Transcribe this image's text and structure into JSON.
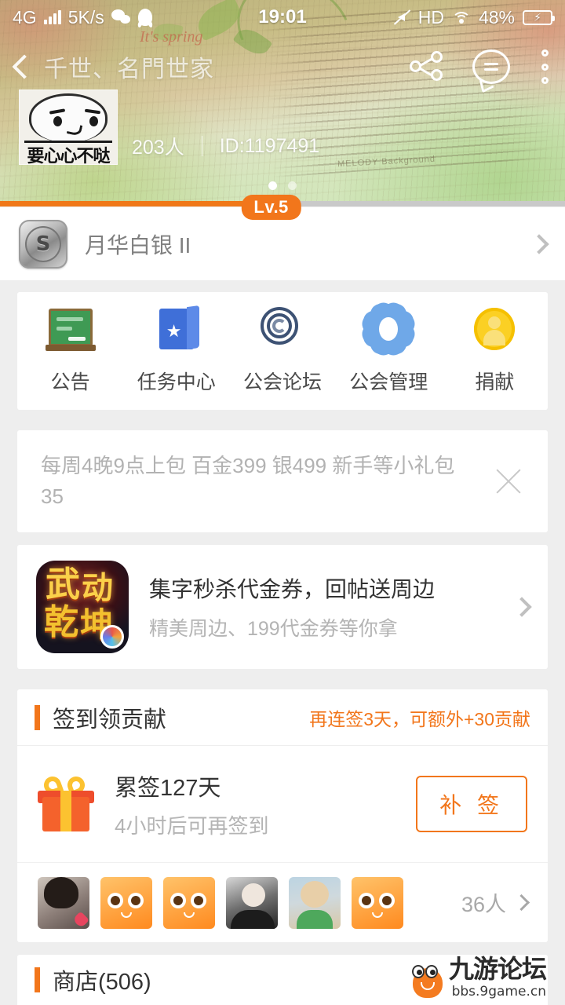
{
  "status_bar": {
    "network_type": "4G",
    "data_speed": "5K/s",
    "time": "19:01",
    "hd_label": "HD",
    "battery_percent": "48%",
    "icons": [
      "signal-bars-icon",
      "wechat-icon",
      "qq-icon",
      "mute-icon",
      "wifi-icon",
      "battery-charging-icon"
    ]
  },
  "header": {
    "back_label": "",
    "guild_title": "千世、名門世家",
    "guild_title_shadow": "千世、名門世家",
    "member_count": "203人",
    "guild_id": "ID:1197491",
    "avatar_caption": "要心心不哒",
    "page_dots": 2,
    "active_dot": 0,
    "level_badge": "Lv.5",
    "level_progress_percent": 48,
    "accent_color": "#f2761b"
  },
  "medal_row": {
    "badge_letter": "S",
    "name": "月华白银 II"
  },
  "icon_grid": [
    {
      "label": "公告",
      "icon": "announcement-board-icon"
    },
    {
      "label": "任务中心",
      "icon": "task-book-icon"
    },
    {
      "label": "公会论坛",
      "icon": "forum-spiral-icon"
    },
    {
      "label": "公会管理",
      "icon": "guild-gear-icon"
    },
    {
      "label": "捐献",
      "icon": "donate-coin-icon"
    }
  ],
  "announcement": {
    "text": "每周4晚9点上包 百金399 银499 新手等小礼包35",
    "close_icon": "close-icon"
  },
  "promo": {
    "game_name": "武动乾坤",
    "game_char_1": "武",
    "game_char_2": "动",
    "game_char_3": "乾",
    "game_char_4": "坤",
    "title": "集字秒杀代金券，回帖送周边",
    "subtitle": "精美周边、199代金券等你拿"
  },
  "signin": {
    "section_title": "签到领贡献",
    "hint": "再连签3天，可额外+30贡献",
    "total_days": "累签127天",
    "next_signin": "4小时后可再签到",
    "button_label": "补 签",
    "participants": "36人",
    "avatars": [
      "av-girl",
      "av-cat",
      "av-cat",
      "av-man",
      "av-baby",
      "av-cat"
    ]
  },
  "shop": {
    "section_title": "商店(506)"
  },
  "watermark": {
    "title": "九游论坛",
    "url": "bbs.9game.cn"
  }
}
